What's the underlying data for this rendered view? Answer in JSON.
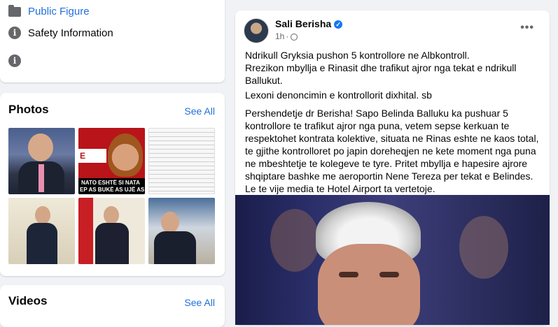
{
  "sidebar": {
    "about": {
      "items": [
        {
          "label": "Public Figure",
          "icon": "folder-icon"
        },
        {
          "label": "Safety Information",
          "icon": "info-icon"
        },
        {
          "label": "",
          "icon": "info-icon"
        }
      ]
    },
    "photos": {
      "title": "Photos",
      "see_all": "See All",
      "overlay_text": [
        "NATO ESHTË SI NATA",
        "EP AS BUKË AS UJË AS",
        "E LEKU"
      ]
    },
    "videos": {
      "title": "Videos",
      "see_all": "See All"
    }
  },
  "post": {
    "author": "Sali Berisha",
    "time": "1h",
    "paragraphs": [
      "Ndrikull Gryksia pushon 5 kontrollore ne Albkontroll.\nRrezikon mbyllja e Rinasit dhe trafikut ajror nga tekat e ndrikull Ballukut.",
      "Lexoni denoncimin e kontrollorit dixhital. sb",
      "Pershendetje dr Berisha! Sapo Belinda Balluku ka pushuar 5 kontrollore te trafikut ajror nga puna, vetem sepse kerkuan te respektohet kontrata kolektive, situata ne Rinas eshte ne kaos total, te gjithe kontrolloret po japin doreheqjen ne kete moment nga puna ne mbeshtetje te kolegeve te tyre. Pritet mbyllja e hapesire ajrore shqiptare bashke me aeroportin Nene Tereza per tekat e Belindes. Le te vije media te Hotel Airport ta vertetoje."
    ]
  },
  "colors": {
    "link": "#216fdb",
    "verified": "#1877f2",
    "bg": "#f0f2f5"
  }
}
